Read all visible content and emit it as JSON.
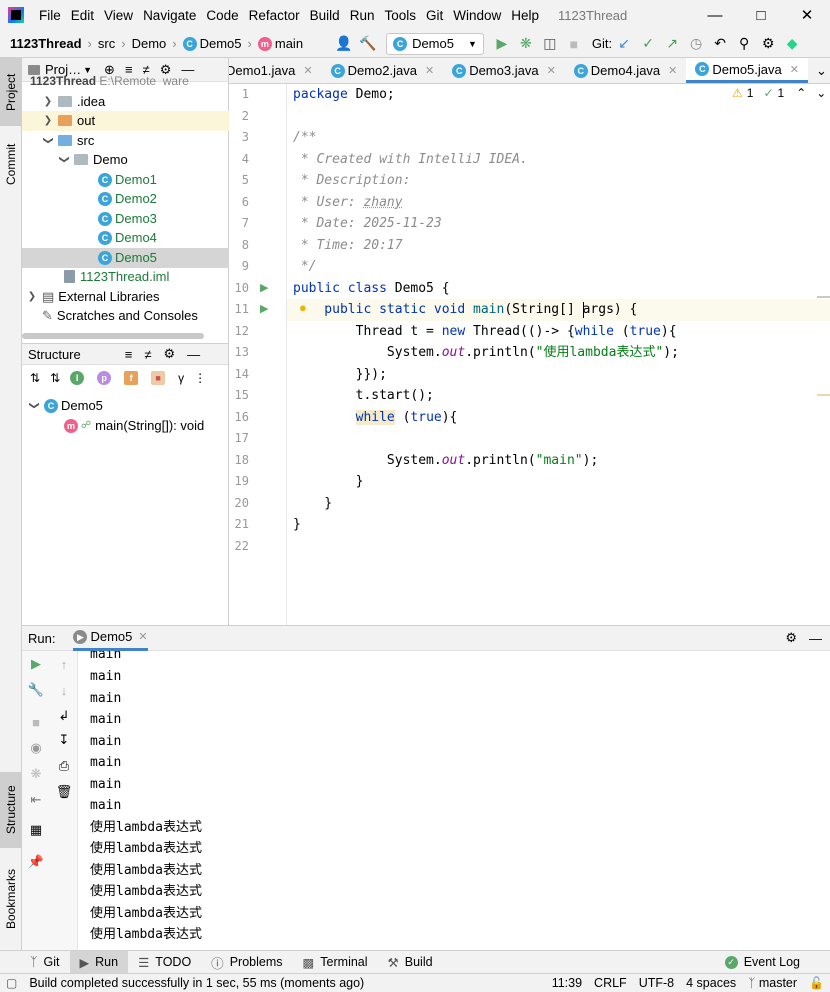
{
  "menubar": {
    "items": [
      "File",
      "Edit",
      "View",
      "Navigate",
      "Code",
      "Refactor",
      "Build",
      "Run",
      "Tools",
      "Git",
      "Window",
      "Help"
    ],
    "title": "1123Thread"
  },
  "navbar": {
    "project": "1123Thread",
    "crumbs": [
      "src",
      "Demo",
      "Demo5",
      "main"
    ],
    "run_config": "Demo5",
    "git_label": "Git:"
  },
  "left_tabs": {
    "project": "Project",
    "commit": "Commit",
    "structure": "Structure",
    "bookmarks": "Bookmarks"
  },
  "project_panel": {
    "title": "Proj…",
    "root": "1123Thread",
    "root_path": "E:\\Remote_ware",
    "items": [
      ".idea",
      "out",
      "src",
      "Demo",
      "Demo1",
      "Demo2",
      "Demo3",
      "Demo4",
      "Demo5",
      "1123Thread.iml",
      "External Libraries",
      "Scratches and Consoles"
    ]
  },
  "structure_panel": {
    "title": "Structure",
    "class": "Demo5",
    "method": "main(String[]): void"
  },
  "editor": {
    "tabs": [
      "Demo1.java",
      "Demo2.java",
      "Demo3.java",
      "Demo4.java",
      "Demo5.java"
    ],
    "inspection": {
      "warnings": "1",
      "ok": "1"
    },
    "lines": [
      "1",
      "2",
      "3",
      "4",
      "5",
      "6",
      "7",
      "8",
      "9",
      "10",
      "11",
      "12",
      "13",
      "14",
      "15",
      "16",
      "17",
      "18",
      "19",
      "20",
      "21",
      "22"
    ],
    "code": {
      "l1_kw": "package",
      "l1_rest": " Demo;",
      "l3": "/**",
      "l4": " * Created with IntelliJ IDEA.",
      "l5": " * Description:",
      "l6a": " * User: ",
      "l6b": "zhany",
      "l7": " * Date: 2025-11-23",
      "l8": " * Time: 20:17",
      "l9": " */",
      "l10a": "public class",
      "l10b": " Demo5 {",
      "l11a": "    public static void ",
      "l11b": "main",
      "l11c": "(String[] args) {",
      "l12a": "        Thread t = ",
      "l12b": "new",
      "l12c": " Thread(()-> {",
      "l12d": "while",
      "l12e": " (",
      "l12f": "true",
      "l12g": "){",
      "l13a": "            System.",
      "l13b": "out",
      "l13c": ".println(",
      "l13d": "\"使用lambda表达式\"",
      "l13e": ");",
      "l14": "        }});",
      "l15": "        t.start();",
      "l16a": "        ",
      "l16b": "while",
      "l16c": " (",
      "l16d": "true",
      "l16e": "){",
      "l18a": "            System.",
      "l18b": "out",
      "l18c": ".println(",
      "l18d": "\"main\"",
      "l18e": ");",
      "l19": "        }",
      "l20": "    }",
      "l21": "}"
    }
  },
  "run_panel": {
    "label": "Run:",
    "tab": "Demo5",
    "output": [
      "main",
      "main",
      "main",
      "main",
      "main",
      "main",
      "main",
      "main",
      "使用lambda表达式",
      "使用lambda表达式",
      "使用lambda表达式",
      "使用lambda表达式",
      "使用lambda表达式",
      "使用lambda表达式"
    ]
  },
  "toolwindows": {
    "git": "Git",
    "run": "Run",
    "todo": "TODO",
    "problems": "Problems",
    "terminal": "Terminal",
    "build": "Build",
    "event_log": "Event Log"
  },
  "status": {
    "message": "Build completed successfully in 1 sec, 55 ms (moments ago)",
    "time": "11:39",
    "line_sep": "CRLF",
    "encoding": "UTF-8",
    "indent": "4 spaces",
    "branch": "master"
  }
}
